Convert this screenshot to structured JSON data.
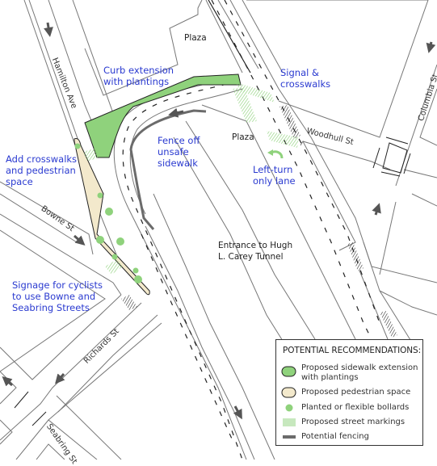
{
  "map": {
    "colors": {
      "sidewalk_extension": "#8fd27c",
      "pedestrian_space": "#f3e9cc",
      "bollards": "#8fd27c",
      "street_markings": "#8fd27c",
      "fencing": "#6b6b6b",
      "annotation_text": "#2a3ad0",
      "crosswalk_existing": "#222222"
    },
    "annotations": {
      "curb_extension": [
        "Curb extension",
        "with plantings"
      ],
      "signal_crosswalks": [
        "Signal &",
        "crosswalks"
      ],
      "add_crosswalks": [
        "Add crosswalks",
        "and pedestrian",
        "space"
      ],
      "fence_off": [
        "Fence off",
        "unsafe",
        "sidewalk"
      ],
      "left_turn": [
        "Left-turn",
        "only lane"
      ],
      "signage_cyclists": [
        "Signage for cyclists",
        "to use Bowne and",
        "Seabring Streets"
      ]
    },
    "places": {
      "plaza_north": "Plaza",
      "plaza_south": "Plaza",
      "tunnel": [
        "Entrance to Hugh",
        "L. Carey Tunnel"
      ]
    },
    "streets": {
      "hamilton": "Hamilton Ave",
      "columbia": "Columbia St",
      "woodhull": "Woodhull St",
      "bowne": "Bowne St",
      "richards": "Richards St",
      "seabring": "Seabring St"
    }
  },
  "legend": {
    "title": "POTENTIAL RECOMMENDATIONS:",
    "items": [
      {
        "icon": "green-pill-swatch",
        "label": [
          "Proposed sidewalk extension",
          "with plantings"
        ]
      },
      {
        "icon": "beige-pill-swatch",
        "label": [
          "Proposed pedestrian space"
        ]
      },
      {
        "icon": "green-dot",
        "label": [
          "Planted or flexible bollards"
        ]
      },
      {
        "icon": "green-hatch",
        "label": [
          "Proposed street markings"
        ]
      },
      {
        "icon": "gray-bar",
        "label": [
          "Potential fencing"
        ]
      }
    ]
  }
}
